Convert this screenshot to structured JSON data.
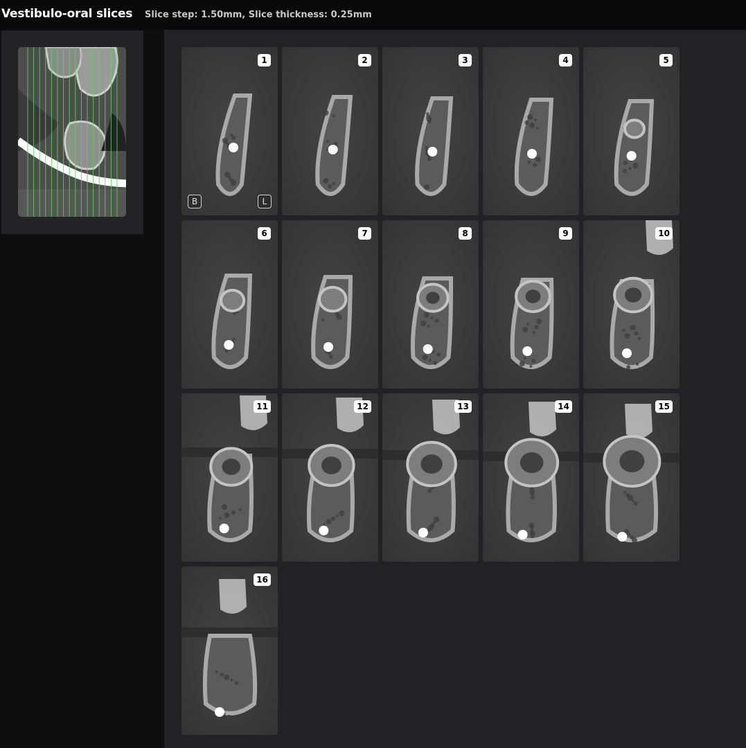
{
  "header": {
    "title": "Vestibulo-oral slices",
    "subtitle": "Slice step: 1.50mm, Slice thickness: 0.25mm"
  },
  "overview": {
    "image": "panoramic-slice-location-image",
    "slice_line_color": "#5fd35f"
  },
  "orientation": {
    "buccal": "B",
    "lingual": "L"
  },
  "colors": {
    "background": "#212126",
    "badge": "#ffffff",
    "marker": "#ffffff"
  },
  "slices": [
    {
      "label": "1"
    },
    {
      "label": "2"
    },
    {
      "label": "3"
    },
    {
      "label": "4"
    },
    {
      "label": "5"
    },
    {
      "label": "6"
    },
    {
      "label": "7"
    },
    {
      "label": "8"
    },
    {
      "label": "9"
    },
    {
      "label": "10"
    },
    {
      "label": "11"
    },
    {
      "label": "12"
    },
    {
      "label": "13"
    },
    {
      "label": "14"
    },
    {
      "label": "15"
    },
    {
      "label": "16"
    }
  ]
}
